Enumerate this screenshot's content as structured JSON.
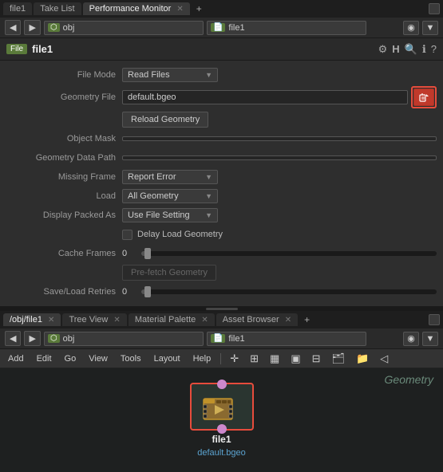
{
  "tabs_top": {
    "items": [
      {
        "label": "file1",
        "active": false,
        "closable": false
      },
      {
        "label": "Take List",
        "active": false,
        "closable": false
      },
      {
        "label": "Performance Monitor",
        "active": true,
        "closable": true
      }
    ],
    "add_label": "+"
  },
  "toolbar": {
    "back_icon": "◀",
    "forward_icon": "▶",
    "obj_label": "obj",
    "file_label": "file1",
    "pin_icon": "◉"
  },
  "file_header": {
    "file_label": "File",
    "title": "file1",
    "gear_icon": "⚙",
    "h_icon": "H",
    "search_icon": "🔍",
    "info_icon": "ℹ",
    "help_icon": "?"
  },
  "params": {
    "file_mode_label": "File Mode",
    "file_mode_value": "Read Files",
    "geometry_file_label": "Geometry File",
    "geometry_file_value": "default.bgeo",
    "reload_btn": "Reload Geometry",
    "object_mask_label": "Object Mask",
    "geo_data_path_label": "Geometry Data Path",
    "missing_frame_label": "Missing Frame",
    "missing_frame_value": "Report Error",
    "load_label": "Load",
    "load_value": "All Geometry",
    "display_packed_label": "Display Packed As",
    "display_packed_value": "Use File Setting",
    "delay_load_label": "Delay Load Geometry",
    "delay_load_checked": false,
    "cache_frames_label": "Cache Frames",
    "cache_frames_value": "0",
    "prefetch_btn": "Pre-fetch Geometry",
    "save_load_label": "Save/Load Retries",
    "save_load_value": "0"
  },
  "tabs_bottom": {
    "items": [
      {
        "label": "/obj/file1",
        "active": true,
        "closable": true
      },
      {
        "label": "Tree View",
        "active": false,
        "closable": true
      },
      {
        "label": "Material Palette",
        "active": false,
        "closable": true
      },
      {
        "label": "Asset Browser",
        "active": false,
        "closable": true
      }
    ],
    "add_label": "+"
  },
  "bottom_toolbar": {
    "back_icon": "◀",
    "forward_icon": "▶",
    "obj_label": "obj",
    "file_label": "file1",
    "pin_icon": "◉"
  },
  "menu": {
    "items": [
      "Add",
      "Edit",
      "Go",
      "View",
      "Tools",
      "Layout",
      "Help"
    ]
  },
  "viewport": {
    "label": "Geometry",
    "node_name": "file1",
    "node_file": "default.bgeo"
  }
}
